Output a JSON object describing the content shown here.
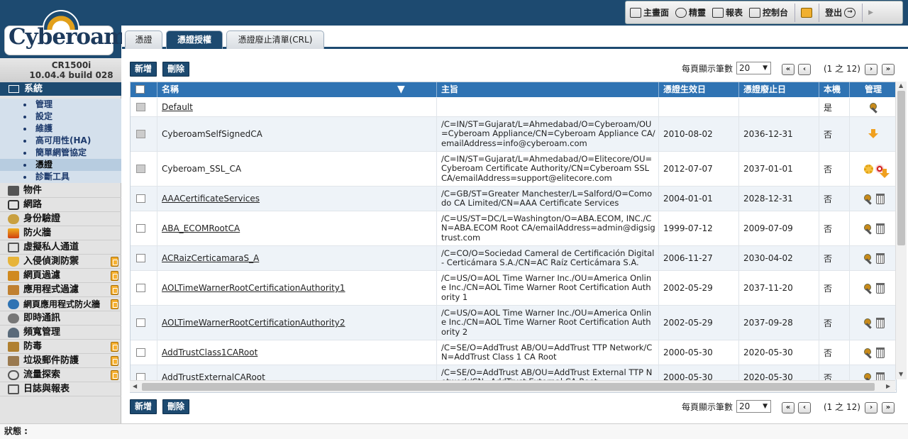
{
  "app": {
    "logo": "Cyberoam",
    "device_model": "CR1500i",
    "firmware": "10.04.4 build 028"
  },
  "toolbar": {
    "items": [
      {
        "label": "主畫面",
        "icon": "home-icon"
      },
      {
        "label": "精靈",
        "icon": "wizard-icon"
      },
      {
        "label": "報表",
        "icon": "report-icon"
      },
      {
        "label": "控制台",
        "icon": "console-icon"
      },
      {
        "label": "",
        "icon": "lock-icon"
      },
      {
        "label": "登出",
        "icon": "logout-icon"
      }
    ]
  },
  "sidebar": {
    "system": {
      "label": "系統",
      "subitems": [
        "管理",
        "設定",
        "維護",
        "高可用性(HA)",
        "簡單網管協定",
        "憑證",
        "診斷工具"
      ],
      "selected": "憑證"
    },
    "items": [
      {
        "label": "物件",
        "licensed": false
      },
      {
        "label": "網路",
        "licensed": false
      },
      {
        "label": "身份驗證",
        "licensed": false
      },
      {
        "label": "防火牆",
        "licensed": false
      },
      {
        "label": "虛擬私人通道",
        "licensed": false
      },
      {
        "label": "入侵偵測防禦",
        "licensed": true
      },
      {
        "label": "網頁過濾",
        "licensed": true
      },
      {
        "label": "應用程式過濾",
        "licensed": true
      },
      {
        "label": "網頁應用程式防火牆",
        "licensed": true
      },
      {
        "label": "即時通訊",
        "licensed": false
      },
      {
        "label": "頻寬管理",
        "licensed": false
      },
      {
        "label": "防毒",
        "licensed": true
      },
      {
        "label": "垃圾郵件防護",
        "licensed": true
      },
      {
        "label": "流量探索",
        "licensed": true
      },
      {
        "label": "日誌與報表",
        "licensed": false
      }
    ]
  },
  "tabs": [
    {
      "label": "憑證",
      "active": false
    },
    {
      "label": "憑證授權",
      "active": true
    },
    {
      "label": "憑證廢止清單(CRL)",
      "active": false
    }
  ],
  "actions": {
    "add": "新增",
    "delete": "刪除"
  },
  "pager": {
    "per_page_label": "每頁顯示筆數",
    "per_page_value": "20",
    "position": "(1 之 12)",
    "first": "«",
    "prev": "‹",
    "next": "›",
    "last": "»"
  },
  "table": {
    "columns": [
      "名稱",
      "主旨",
      "憑證生效日",
      "憑證廢止日",
      "本機",
      "管理"
    ],
    "rows": [
      {
        "name": "Default",
        "link": true,
        "subject": "",
        "valid_from": "",
        "valid_to": "",
        "local": "是",
        "checkbox_disabled": true,
        "actions": [
          "wrench"
        ]
      },
      {
        "name": "CyberoamSelfSignedCA",
        "link": false,
        "subject": "/C=IN/ST=Gujarat/L=Ahmedabad/O=Cyberoam/OU=Cyberoam Appliance/CN=Cyberoam Appliance CA/emailAddress=info@cyberoam.com",
        "valid_from": "2010-08-02",
        "valid_to": "2036-12-31",
        "local": "否",
        "checkbox_disabled": true,
        "actions": [
          "download"
        ]
      },
      {
        "name": "Cyberoam_SSL_CA",
        "link": false,
        "subject": "/C=IN/ST=Gujarat/L=Ahmedabad/O=Elitecore/OU=Cyberoam Certificate Authority/CN=Cyberoam SSL CA/emailAddress=support@elitecore.com",
        "valid_from": "2012-07-07",
        "valid_to": "2037-01-01",
        "local": "否",
        "checkbox_disabled": true,
        "actions": [
          "gear",
          "download-highlighted"
        ]
      },
      {
        "name": "AAACertificateServices",
        "link": true,
        "subject": "/C=GB/ST=Greater Manchester/L=Salford/O=Comodo CA Limited/CN=AAA Certificate Services",
        "valid_from": "2004-01-01",
        "valid_to": "2028-12-31",
        "local": "否",
        "checkbox_disabled": false,
        "actions": [
          "wrench",
          "trash"
        ]
      },
      {
        "name": "ABA_ECOMRootCA",
        "link": true,
        "subject": "/C=US/ST=DC/L=Washington/O=ABA.ECOM, INC./CN=ABA.ECOM Root CA/emailAddress=admin@digsigtrust.com",
        "valid_from": "1999-07-12",
        "valid_to": "2009-07-09",
        "local": "否",
        "checkbox_disabled": false,
        "actions": [
          "wrench",
          "trash"
        ]
      },
      {
        "name": "ACRaizCerticamaraS_A",
        "link": true,
        "subject": "/C=CO/O=Sociedad Cameral de Certificación Digital - Certicámara S.A./CN=AC Raíz Certicámara S.A.",
        "valid_from": "2006-11-27",
        "valid_to": "2030-04-02",
        "local": "否",
        "checkbox_disabled": false,
        "actions": [
          "wrench",
          "trash"
        ]
      },
      {
        "name": "AOLTimeWarnerRootCertificationAuthority1",
        "link": true,
        "subject": "/C=US/O=AOL Time Warner Inc./OU=America Online Inc./CN=AOL Time Warner Root Certification Authority 1",
        "valid_from": "2002-05-29",
        "valid_to": "2037-11-20",
        "local": "否",
        "checkbox_disabled": false,
        "actions": [
          "wrench",
          "trash"
        ]
      },
      {
        "name": "AOLTimeWarnerRootCertificationAuthority2",
        "link": true,
        "subject": "/C=US/O=AOL Time Warner Inc./OU=America Online Inc./CN=AOL Time Warner Root Certification Authority 2",
        "valid_from": "2002-05-29",
        "valid_to": "2037-09-28",
        "local": "否",
        "checkbox_disabled": false,
        "actions": [
          "wrench",
          "trash"
        ]
      },
      {
        "name": "AddTrustClass1CARoot",
        "link": true,
        "subject": "/C=SE/O=AddTrust AB/OU=AddTrust TTP Network/CN=AddTrust Class 1 CA Root",
        "valid_from": "2000-05-30",
        "valid_to": "2020-05-30",
        "local": "否",
        "checkbox_disabled": false,
        "actions": [
          "wrench",
          "trash"
        ]
      },
      {
        "name": "AddTrustExternalCARoot",
        "link": true,
        "subject": "/C=SE/O=AddTrust AB/OU=AddTrust External TTP Network/CN=AddTrust External CA Root",
        "valid_from": "2000-05-30",
        "valid_to": "2020-05-30",
        "local": "否",
        "checkbox_disabled": false,
        "actions": [
          "wrench",
          "trash"
        ]
      }
    ]
  },
  "status": {
    "label": "狀態 :"
  }
}
